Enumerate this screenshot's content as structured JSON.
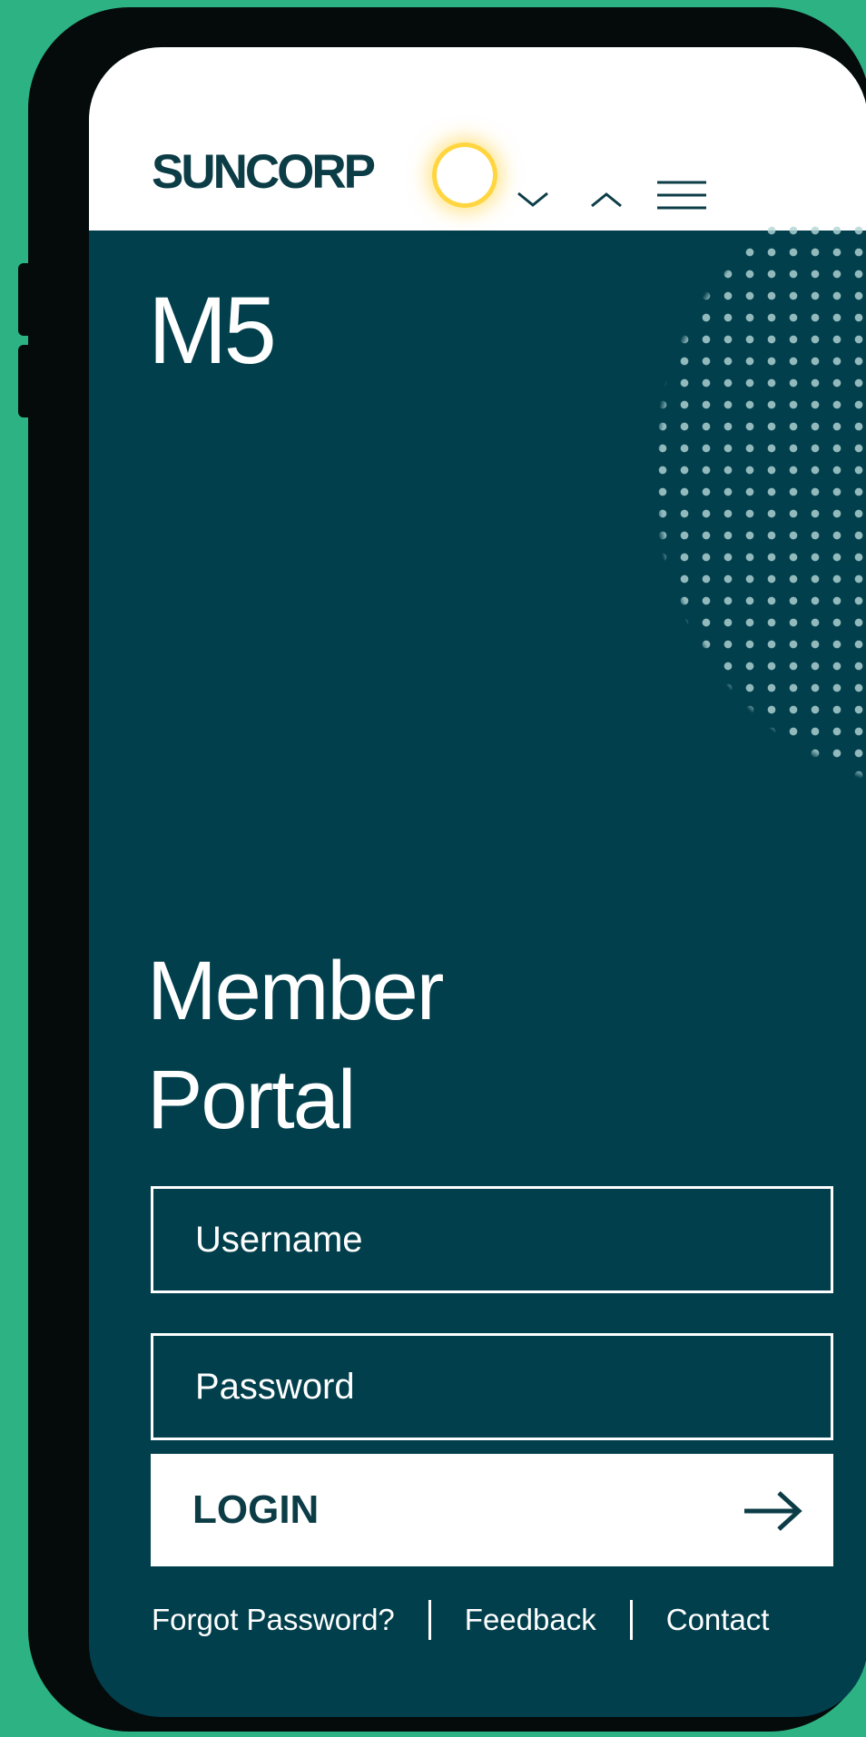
{
  "app": {
    "brand": "SUNCORP",
    "title": "M5",
    "portal_title_line1": "Member",
    "portal_title_line2": "Portal"
  },
  "header": {
    "icons": [
      "chevron-down-icon",
      "chevron-up-icon",
      "menu-icon"
    ]
  },
  "login_form": {
    "username_placeholder": "Username",
    "username_value": "",
    "password_placeholder": "Password",
    "password_value": "",
    "login_label": "LOGIN"
  },
  "footer": {
    "links": [
      "Forgot Password?",
      "Feedback",
      "Contact"
    ]
  },
  "colors": {
    "background": "#2db383",
    "screen": "#013f4c",
    "header": "#ffffff",
    "brand_text": "#0c3d47",
    "sun_accent": "#ffd640"
  }
}
